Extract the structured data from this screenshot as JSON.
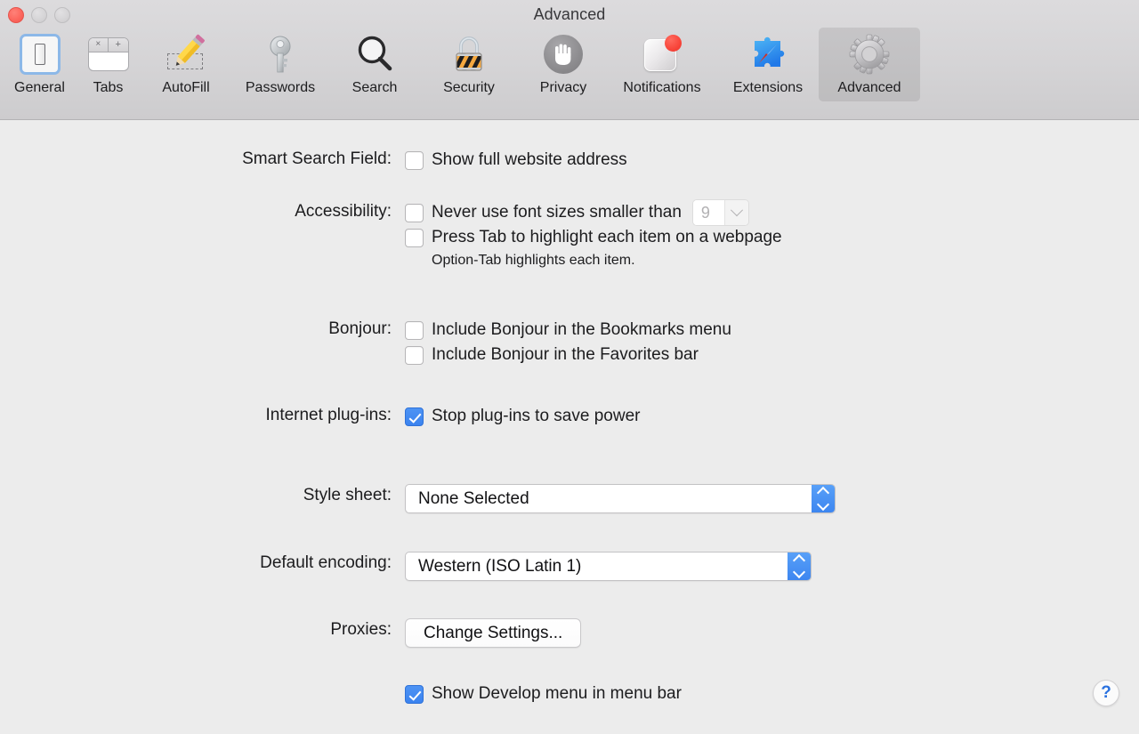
{
  "window": {
    "title": "Advanced",
    "traffic_lights": [
      {
        "name": "close",
        "color": "#fd6a61",
        "enabled": true
      },
      {
        "name": "minimize",
        "color": "#d6d5d7",
        "enabled": false
      },
      {
        "name": "zoom",
        "color": "#d6d5d7",
        "enabled": false
      }
    ]
  },
  "toolbar": {
    "selected": "Advanced",
    "tabs": [
      {
        "label": "General",
        "icon": "general-icon",
        "selected": false
      },
      {
        "label": "Tabs",
        "icon": "tabs-icon",
        "selected": false
      },
      {
        "label": "AutoFill",
        "icon": "autofill-icon",
        "selected": false
      },
      {
        "label": "Passwords",
        "icon": "passwords-key-icon",
        "selected": false
      },
      {
        "label": "Search",
        "icon": "search-icon",
        "selected": false
      },
      {
        "label": "Security",
        "icon": "security-lock-icon",
        "selected": false
      },
      {
        "label": "Privacy",
        "icon": "privacy-hand-icon",
        "selected": false
      },
      {
        "label": "Notifications",
        "icon": "notifications-icon",
        "selected": false
      },
      {
        "label": "Extensions",
        "icon": "extensions-icon",
        "selected": false
      },
      {
        "label": "Advanced",
        "icon": "advanced-gear-icon",
        "selected": true
      }
    ],
    "tabs_icon_close": "×",
    "tabs_icon_new": "+"
  },
  "settings": {
    "smart_search": {
      "label": "Smart Search Field:",
      "show_full_address": {
        "text": "Show full website address",
        "checked": false
      }
    },
    "accessibility": {
      "label": "Accessibility:",
      "min_font": {
        "text": "Never use font sizes smaller than",
        "checked": false,
        "size_value": "9",
        "size_enabled": false
      },
      "press_tab": {
        "text": "Press Tab to highlight each item on a webpage",
        "checked": false
      },
      "hint": "Option-Tab highlights each item."
    },
    "bonjour": {
      "label": "Bonjour:",
      "bookmarks_menu": {
        "text": "Include Bonjour in the Bookmarks menu",
        "checked": false
      },
      "favorites_bar": {
        "text": "Include Bonjour in the Favorites bar",
        "checked": false
      }
    },
    "plugins": {
      "label": "Internet plug-ins:",
      "stop_to_save_power": {
        "text": "Stop plug-ins to save power",
        "checked": true
      }
    },
    "style_sheet": {
      "label": "Style sheet:",
      "value": "None Selected"
    },
    "default_encoding": {
      "label": "Default encoding:",
      "value": "Western (ISO Latin 1)"
    },
    "proxies": {
      "label": "Proxies:",
      "button": "Change Settings..."
    },
    "develop_menu": {
      "text": "Show Develop menu in menu bar",
      "checked": true
    }
  },
  "help": {
    "glyph": "?"
  },
  "colors": {
    "accent_blue": "#3b83ef",
    "window_bg": "#ececec",
    "toolbar_bg": "#d5d4d6",
    "selected_tab_bg": "rgba(0,0,0,0.085)",
    "close_red": "#fd6a61",
    "notification_badge": "#f8453a"
  }
}
